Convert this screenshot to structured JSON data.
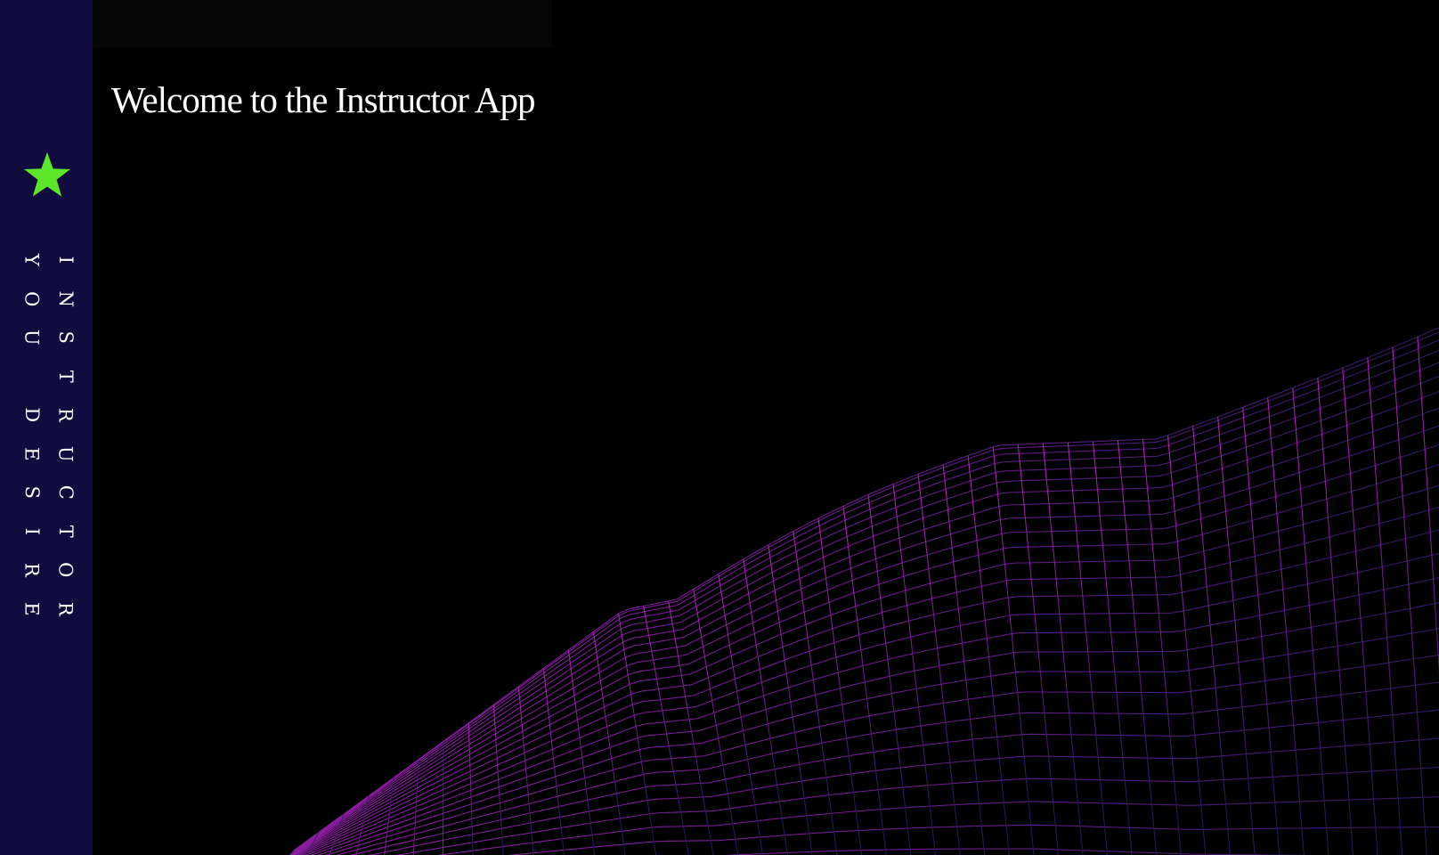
{
  "sidebar": {
    "logo_icon": "star-icon",
    "logo_color": "#5ce62a",
    "background": "#100d3e",
    "brand_line_1": [
      "I",
      "N",
      "S",
      "T",
      "R",
      "U",
      "C",
      "T",
      "O",
      "R"
    ],
    "brand_line_2": [
      "Y",
      "O",
      "U",
      "",
      "D",
      "E",
      "S",
      "I",
      "R",
      "E"
    ]
  },
  "main": {
    "title": "Welcome to the Instructor App",
    "background_graphic": "wireframe-mesh",
    "mesh_colors": [
      "#a21caf",
      "#2a1c6e"
    ]
  }
}
